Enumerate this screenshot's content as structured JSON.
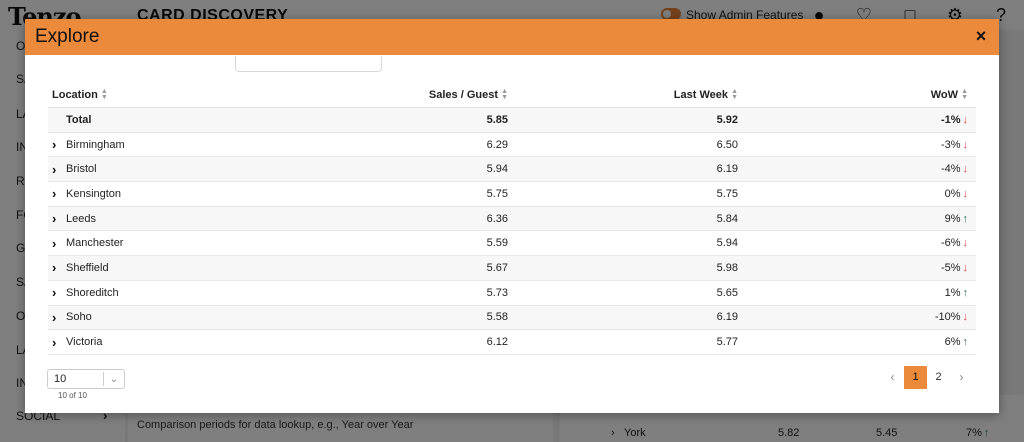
{
  "background": {
    "logo": "Tenzo",
    "page_title": "CARD DISCOVERY",
    "admin_toggle_label": "Show Admin Features",
    "sidebar_items": [
      "OV",
      "SA",
      "LA",
      "IN",
      "RE",
      "FO",
      "GI",
      "SA",
      "OI",
      "LA",
      "IN"
    ],
    "sidebar_social": "SOCIAL",
    "panel_text": "Comparison periods for data lookup, e.g., Year over Year",
    "york_row": {
      "location": "York",
      "sales": "5.82",
      "last_week": "5.45",
      "wow": "7%"
    }
  },
  "modal": {
    "title": "Explore",
    "close_glyph": "×",
    "columns": {
      "location": "Location",
      "sales": "Sales / Guest",
      "last_week": "Last Week",
      "wow": "WoW"
    },
    "total": {
      "location": "Total",
      "sales": "5.85",
      "last_week": "5.92",
      "wow": "-1%",
      "trend": "down"
    },
    "rows": [
      {
        "location": "Birmingham",
        "sales": "6.29",
        "last_week": "6.50",
        "wow": "-3%",
        "trend": "down"
      },
      {
        "location": "Bristol",
        "sales": "5.94",
        "last_week": "6.19",
        "wow": "-4%",
        "trend": "down"
      },
      {
        "location": "Kensington",
        "sales": "5.75",
        "last_week": "5.75",
        "wow": "0%",
        "trend": "down"
      },
      {
        "location": "Leeds",
        "sales": "6.36",
        "last_week": "5.84",
        "wow": "9%",
        "trend": "up"
      },
      {
        "location": "Manchester",
        "sales": "5.59",
        "last_week": "5.94",
        "wow": "-6%",
        "trend": "down"
      },
      {
        "location": "Sheffield",
        "sales": "5.67",
        "last_week": "5.98",
        "wow": "-5%",
        "trend": "down"
      },
      {
        "location": "Shoreditch",
        "sales": "5.73",
        "last_week": "5.65",
        "wow": "1%",
        "trend": "up"
      },
      {
        "location": "Soho",
        "sales": "5.58",
        "last_week": "6.19",
        "wow": "-10%",
        "trend": "down"
      },
      {
        "location": "Victoria",
        "sales": "6.12",
        "last_week": "5.77",
        "wow": "6%",
        "trend": "up"
      }
    ],
    "page_size": "10",
    "page_count": "10 of 10",
    "pagination": {
      "prev": "‹",
      "pages": [
        "1",
        "2"
      ],
      "next": "›",
      "current": "1"
    },
    "colors": {
      "accent": "#ec8a3c",
      "down": "#e04343",
      "up": "#2f7a5a"
    }
  }
}
